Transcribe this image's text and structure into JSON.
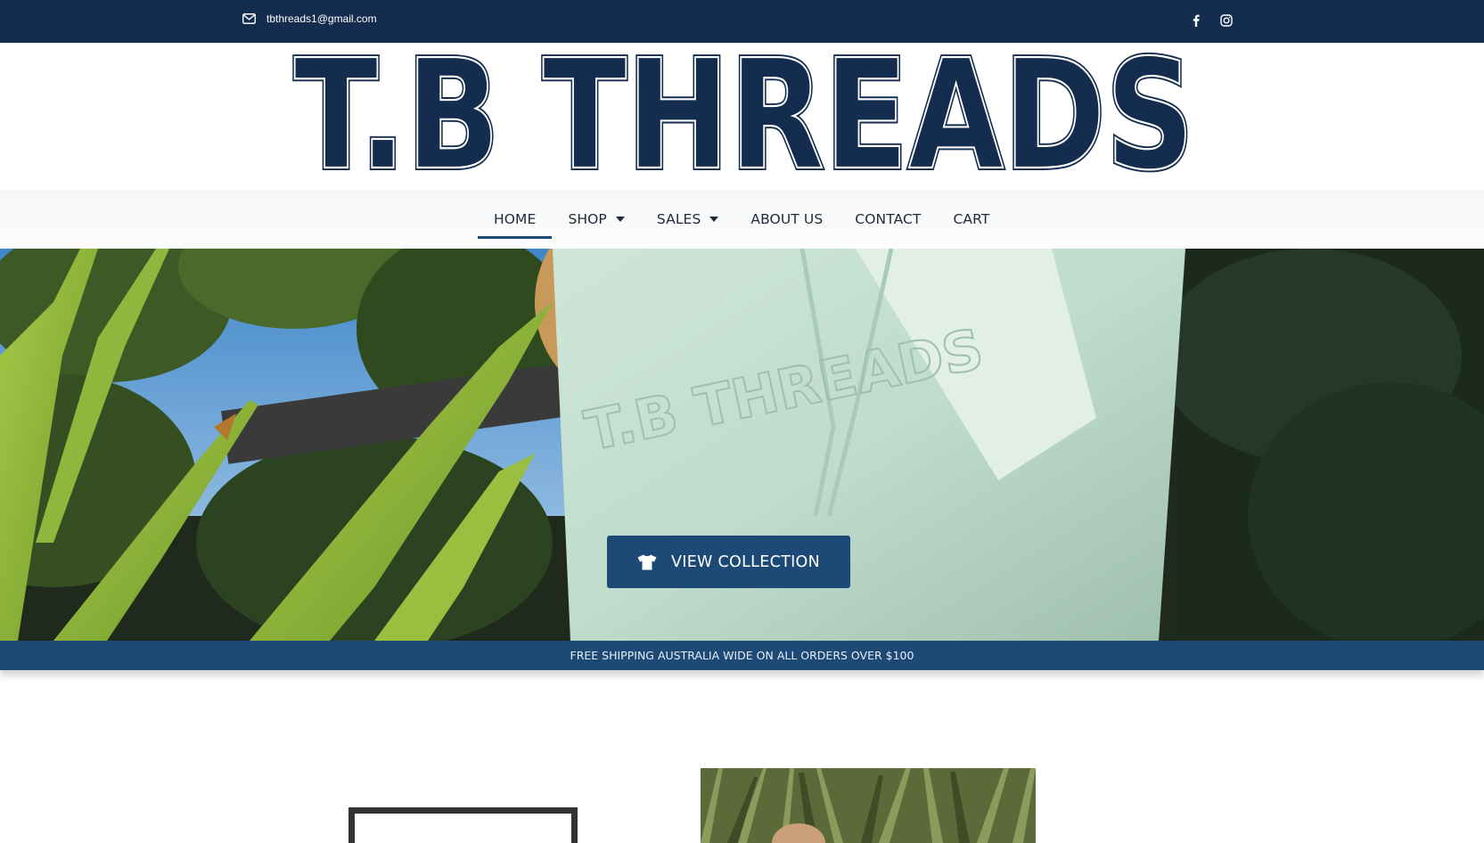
{
  "topbar": {
    "email": "tbthreads1@gmail.com",
    "email_icon": "envelope-icon",
    "social_icons": [
      "facebook-icon",
      "instagram-icon"
    ]
  },
  "logo": {
    "text": "T.B THREADS",
    "color": "#142d4f"
  },
  "nav": {
    "items": [
      {
        "label": "HOME",
        "active": true,
        "dropdown": false
      },
      {
        "label": "SHOP",
        "active": false,
        "dropdown": true
      },
      {
        "label": "SALES",
        "active": false,
        "dropdown": true
      },
      {
        "label": "ABOUT US",
        "active": false,
        "dropdown": false
      },
      {
        "label": "CONTACT",
        "active": false,
        "dropdown": false
      },
      {
        "label": "CART",
        "active": false,
        "dropdown": false
      }
    ]
  },
  "hero": {
    "cta_label": "VIEW COLLECTION",
    "cta_icon": "tshirt-icon",
    "hoodie_print": "T.B THREADS"
  },
  "banner": {
    "text": "FREE SHIPPING AUSTRALIA WIDE ON ALL ORDERS OVER $100"
  },
  "colors": {
    "navy": "#142d4f",
    "accent_blue": "#1d4977",
    "white": "#ffffff"
  }
}
